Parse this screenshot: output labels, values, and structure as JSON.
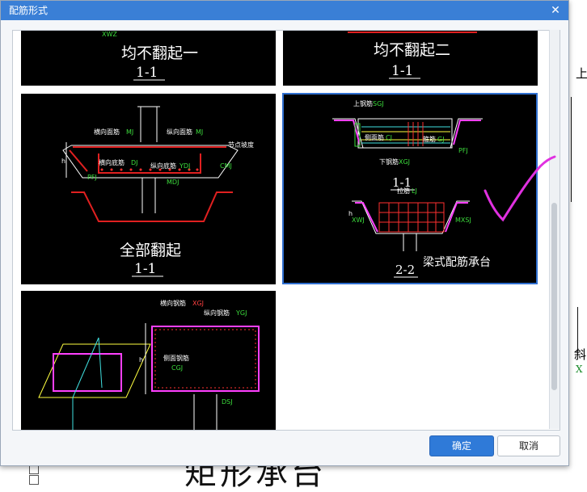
{
  "dialog": {
    "title": "配筋形式",
    "ok_label": "确定",
    "cancel_label": "取消"
  },
  "tiles": [
    {
      "caption": "均不翻起一",
      "section": "1-1",
      "tag": "XWZ"
    },
    {
      "caption": "均不翻起二",
      "section": "1-1"
    },
    {
      "caption": "全部翻起",
      "section": "1-1",
      "labels": {
        "transverse_top": "横向面筋",
        "transverse_top_code": "MJ",
        "longitudinal_top": "纵向面筋",
        "longitudinal_top_code": "MJ",
        "transverse_bottom": "横向底筋",
        "transverse_bottom_code": "DJ",
        "longitudinal_bottom": "纵向底筋",
        "longitudinal_bottom_code": "YDJ",
        "side_code": "CMJ",
        "slope_note": "节点坡度",
        "left_code": "PFJ",
        "mid_code": "MDJ",
        "h": "h"
      }
    },
    {
      "caption": "梁式配筋承台",
      "section_top": "1-1",
      "section_bottom": "2-2",
      "labels": {
        "top_bar": "上钢筋",
        "top_bar_code": "SGJ",
        "bottom_bar": "下钢筋",
        "bottom_bar_code": "XGJ",
        "side_bar": "侧面筋",
        "side_bar_code": "CJ",
        "stirrup": "箍筋",
        "stirrup_code": "GJ",
        "lj": "拉筋",
        "lj_code": "LJ",
        "left_code": "XWJ",
        "right_code": "PFJ",
        "mid_code": "MXSJ",
        "h": "h"
      }
    },
    {
      "labels": {
        "transverse": "横向钢筋",
        "transverse_code": "XGJ",
        "longitudinal": "纵向钢筋",
        "longitudinal_code": "YGJ",
        "side": "侧面钢筋",
        "side_code": "CGJ",
        "h": "h",
        "bottom_code": "DSJ"
      }
    }
  ],
  "background": {
    "big_text": "矩形承台",
    "side_text_1": "上",
    "side_text_2": "斜",
    "side_text_3": "X"
  }
}
